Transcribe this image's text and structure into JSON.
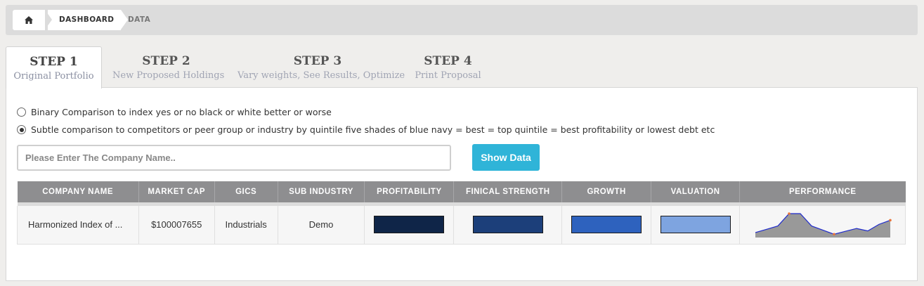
{
  "breadcrumb": {
    "home_icon": "home-icon",
    "items": [
      "DASHBOARD",
      "DATA"
    ]
  },
  "steps": [
    {
      "title": "STEP 1",
      "subtitle": "Original Portfolio",
      "active": true
    },
    {
      "title": "STEP 2",
      "subtitle": "New Proposed Holdings",
      "active": false
    },
    {
      "title": "STEP 3",
      "subtitle": "Vary weights, See Results, Optimize",
      "active": false
    },
    {
      "title": "STEP 4",
      "subtitle": "Print Proposal",
      "active": false
    }
  ],
  "comparison": {
    "options": [
      {
        "label": "Binary Comparison to index yes or no black or white better or worse",
        "selected": false
      },
      {
        "label": "Subtle comparison to competitors or peer group or industry by quintile five shades of blue navy = best = top quintile = best profitability or lowest debt etc",
        "selected": true
      }
    ]
  },
  "search": {
    "placeholder": "Please Enter The Company Name..",
    "value": "",
    "button_label": "Show Data"
  },
  "table": {
    "columns": [
      "COMPANY NAME",
      "MARKET CAP",
      "GICS",
      "SUB INDUSTRY",
      "PROFITABILITY",
      "FINICAL STRENGTH",
      "GROWTH",
      "VALUATION",
      "PERFORMANCE"
    ],
    "rows": [
      {
        "company_name": "Harmonized Index of ...",
        "market_cap": "$100007655",
        "gics": "Industrials",
        "sub_industry": "Demo",
        "profitability_color": "#0f2548",
        "financial_strength_color": "#1c3f7a",
        "growth_color": "#2e62be",
        "valuation_color": "#7ea4e0",
        "performance": [
          12,
          20,
          28,
          58,
          58,
          28,
          18,
          8,
          15,
          22,
          16,
          32,
          42
        ]
      }
    ]
  },
  "colors": {
    "accent": "#2fb4d8",
    "header": "#8e8e90",
    "sparkline_fill": "#999999",
    "sparkline_line": "#1f2bcc",
    "sparkline_marker": "#e8743b"
  }
}
